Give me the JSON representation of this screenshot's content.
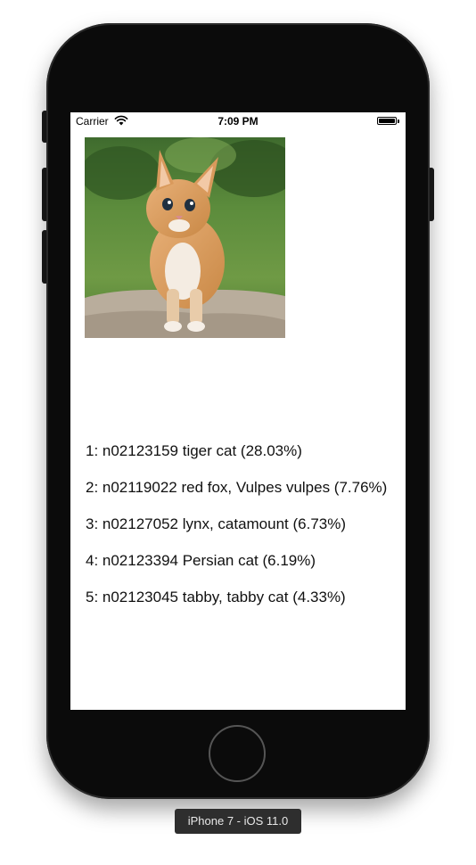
{
  "status_bar": {
    "carrier": "Carrier",
    "wifi_icon": "wifi-icon",
    "time": "7:09 PM",
    "battery_icon": "battery-icon",
    "battery_level": 1.0
  },
  "image": {
    "subject": "kitten"
  },
  "results": [
    {
      "label": "1: n02123159 tiger cat (28.03%)"
    },
    {
      "label": "2: n02119022 red fox, Vulpes vulpes (7.76%)"
    },
    {
      "label": "3: n02127052 lynx, catamount (6.73%)"
    },
    {
      "label": "4: n02123394 Persian cat (6.19%)"
    },
    {
      "label": "5: n02123045 tabby, tabby cat (4.33%)"
    }
  ],
  "device": {
    "label": "iPhone 7 - iOS 11.0",
    "home_button_icon": "home-button-icon"
  }
}
